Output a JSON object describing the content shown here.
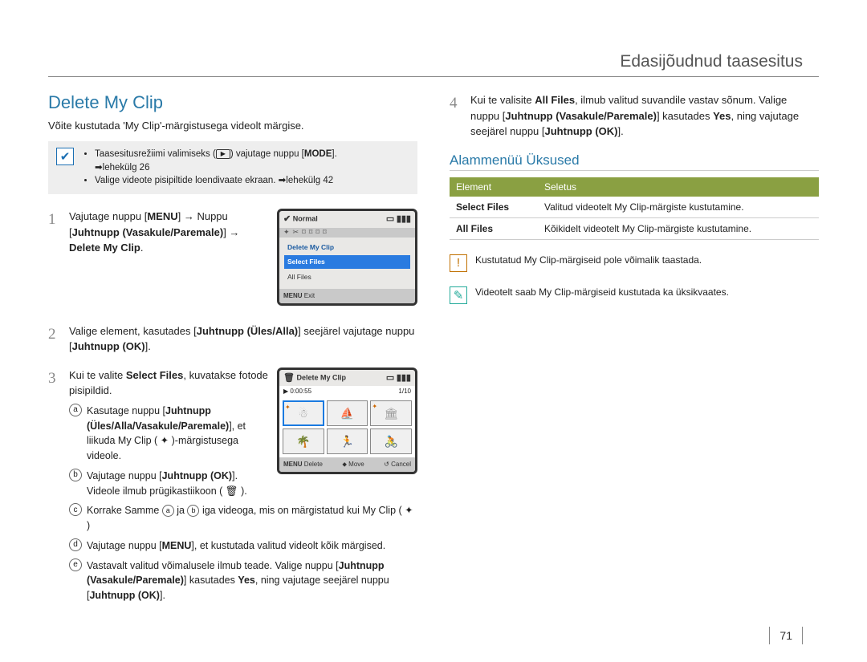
{
  "chapter_title": "Edasijõudnud taasesitus",
  "section_title": "Delete My Clip",
  "intro": "Võite kustutada 'My Clip'-märgistusega videolt märgise.",
  "mode_note": {
    "line1_a": "Taasesitusrežiimi valimiseks (",
    "line1_b": ") vajutage nuppu [",
    "line1_c": "MODE",
    "line1_d": "].",
    "line1_ref": "➡lehekülg 26",
    "line2": "Valige videote pisipiltide loendivaate ekraan. ➡lehekülg 42"
  },
  "lcd1": {
    "title": "Normal",
    "menu_title": "Delete My Clip",
    "item_sel": "Select Files",
    "item_other": "All Files",
    "foot_menu": "MENU",
    "foot_exit": "Exit"
  },
  "lcd2": {
    "title": "Delete My Clip",
    "time": "0:00:55",
    "counter": "1/10",
    "foot_menu": "MENU",
    "foot_delete": "Delete",
    "foot_move": "Move",
    "foot_cancel": "Cancel"
  },
  "steps": {
    "s1_a": "Vajutage nuppu [",
    "s1_b": "MENU",
    "s1_c": "] → Nuppu [",
    "s1_d": "Juhtnupp (Vasakule/Paremale)",
    "s1_e": "] → ",
    "s1_f": "Delete My Clip",
    "s1_g": ".",
    "s2_a": "Valige element, kasutades [",
    "s2_b": "Juhtnupp (Üles/Alla)",
    "s2_c": "] seejärel vajutage nuppu [",
    "s2_d": "Juhtnupp (OK)",
    "s2_e": "].",
    "s3_a": "Kui te valite ",
    "s3_b": "Select Files",
    "s3_c": ", kuvatakse fotode pisipildid.",
    "s4_a": "Kui te valisite ",
    "s4_b": "All Files",
    "s4_c": ", ilmub valitud suvandile vastav sõnum. Valige nuppu [",
    "s4_d": "Juhtnupp (Vasakule/Paremale)",
    "s4_e": "] kasutades ",
    "s4_f": "Yes",
    "s4_g": ", ning vajutage seejärel nuppu [",
    "s4_h": "Juhtnupp (OK)",
    "s4_i": "]."
  },
  "sub": {
    "a_a": "Kasutage nuppu [",
    "a_b": "Juhtnupp (Üles/Alla/Vasakule/Paremale)",
    "a_c": "], et liikuda My Clip ( ✦ )-märgistusega videole.",
    "b_a": "Vajutage nuppu [",
    "b_b": "Juhtnupp (OK)",
    "b_c": "]. Videole ilmub prügikastiikoon ( 🗑 ).",
    "c_a": "Korrake Samme ",
    "c_b": " ja ",
    "c_c": " iga videoga, mis on märgistatud kui My Clip ( ✦ )",
    "d_a": "Vajutage nuppu [",
    "d_b": "MENU",
    "d_c": "], et kustutada valitud videolt kõik märgised.",
    "e_a": "Vastavalt valitud võimalusele ilmub teade. Valige nuppu [",
    "e_b": "Juhtnupp (Vasakule/Paremale)",
    "e_c": "] kasutades ",
    "e_d": "Yes",
    "e_e": ", ning vajutage seejärel nuppu [",
    "e_f": "Juhtnupp (OK)",
    "e_g": "]."
  },
  "submenu_title": "Alammenüü Üksused",
  "table": {
    "h1": "Element",
    "h2": "Seletus",
    "r1c1": "Select Files",
    "r1c2": "Valitud videotelt My Clip-märgiste kustutamine.",
    "r2c1": "All Files",
    "r2c2": "Kõikidelt videotelt My Clip-märgiste kustutamine."
  },
  "note_warn": "Kustutatud My Clip-märgiseid pole võimalik taastada.",
  "note_info": "Videotelt saab My Clip-märgiseid kustutada ka üksikvaates.",
  "page_number": "71"
}
